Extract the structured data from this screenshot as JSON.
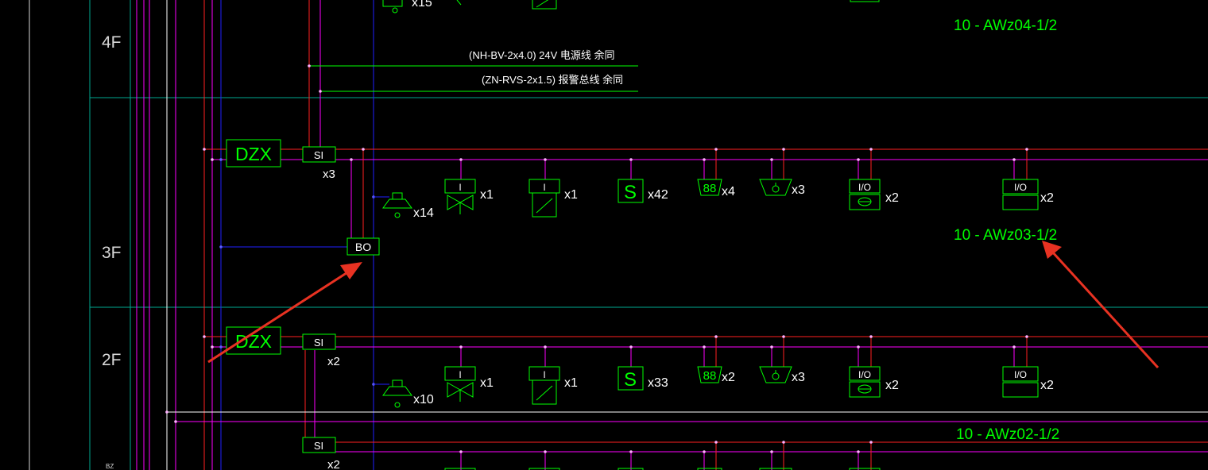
{
  "floors": {
    "f4": "4F",
    "f3": "3F",
    "f2": "2F"
  },
  "cables": {
    "power": "(NH-BV-2x4.0) 24V  电源线 余同",
    "bus": "(ZN-RVS-2x1.5)  报警总线 余同"
  },
  "panels": {
    "dzx_3f": "DZX",
    "dzx_2f": "DZX",
    "si_3f": "SI",
    "si_2f": "SI",
    "si_1f": "SI",
    "bo": "BO"
  },
  "counts_3f": {
    "si": "x3",
    "speaker": "x14",
    "valve": "x1",
    "manual": "x1",
    "smoke": "x42",
    "display": "x4",
    "hydrant": "x3",
    "io1": "x2",
    "io2": "x2"
  },
  "counts_2f": {
    "si": "x2",
    "speaker": "x10",
    "valve": "x1",
    "manual": "x1",
    "smoke": "x33",
    "display": "x2",
    "hydrant": "x3",
    "io1": "x2",
    "io2": "x2"
  },
  "counts_1f": {
    "si": "x2"
  },
  "counts_4f": {
    "speaker": "x15"
  },
  "symbol_text": {
    "io": "I/O",
    "i": "I",
    "s": "S",
    "display": "88"
  },
  "labels": {
    "awz04": "10 - AWz04-1/2",
    "awz03": "10 - AWz03-1/2",
    "awz02": "10 - AWz02-1/2",
    "corner": "BZ"
  },
  "colors": {
    "background": "#000000",
    "green": "#00ff00",
    "magenta": "#ff00ff",
    "red": "#ff2020",
    "blue": "#2020ff",
    "cyan": "#00b0a0",
    "white": "#ffffff",
    "arrow": "#e83222"
  }
}
